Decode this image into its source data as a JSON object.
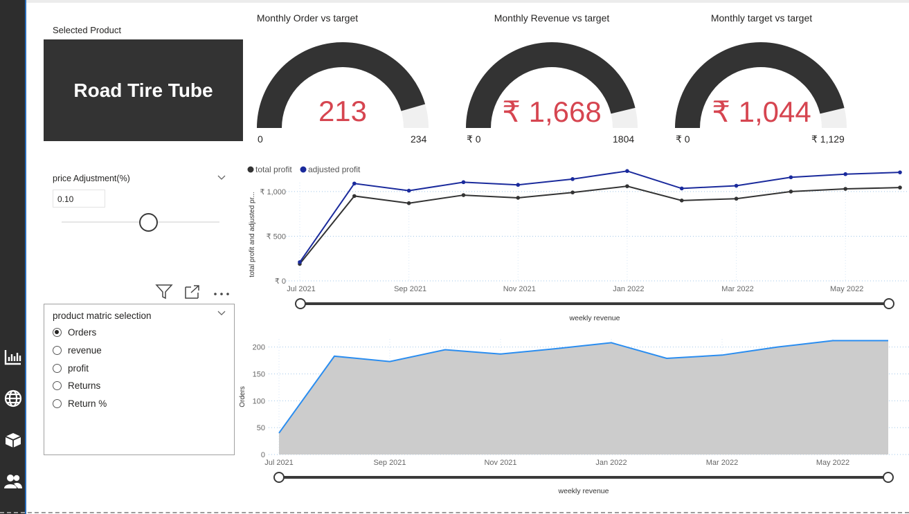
{
  "sidebar": {
    "icons": [
      "bar-chart-icon",
      "globe-icon",
      "box-icon",
      "users-icon"
    ]
  },
  "card": {
    "label": "Selected Product",
    "value": "Road Tire Tube"
  },
  "gauges": [
    {
      "title": "Monthly Order vs target",
      "value": "213",
      "min": "0",
      "max": "234",
      "value_num": 213,
      "max_num": 234
    },
    {
      "title": "Monthly Revenue vs target",
      "value": "₹ 1,668",
      "min": "₹ 0",
      "max": "1804",
      "value_num": 1668,
      "max_num": 1804
    },
    {
      "title": "Monthly target vs target",
      "value": "₹ 1,044",
      "min": "₹ 0",
      "max": "₹ 1,129",
      "value_num": 1044,
      "max_num": 1129
    }
  ],
  "price_slicer": {
    "title": "price Adjustment(%)",
    "value": "0.10",
    "level": 0.55
  },
  "radio": {
    "title": "product matric selection",
    "options": [
      "Orders",
      "revenue",
      "profit",
      "Returns",
      "Return %"
    ],
    "selected": 0
  },
  "colors": {
    "gauge_fill": "#333333",
    "gauge_bg": "#f0f0f0",
    "value_red": "#d64550",
    "adjusted": "#1a2a9c",
    "total": "#333333",
    "area_line": "#2a8df0",
    "area_fill": "#cccccc"
  },
  "chart_data": [
    {
      "type": "line",
      "legend": [
        "total profit",
        "adjusted profit"
      ],
      "legend_position": "top-left",
      "ylabel": "total profit and adjusted pr...",
      "xlabel": "weekly revenue",
      "x_ticks": [
        "Jul 2021",
        "Sep 2021",
        "Nov 2021",
        "Jan 2022",
        "Mar 2022",
        "May 2022"
      ],
      "y_ticks": [
        "₹ 0",
        "₹ 500",
        "₹ 1,000"
      ],
      "ylim": [
        0,
        1100
      ],
      "series": [
        {
          "name": "total profit",
          "values": [
            190,
            950,
            870,
            960,
            930,
            990,
            1060,
            900,
            920,
            1000,
            1030,
            1045
          ]
        },
        {
          "name": "adjusted profit",
          "values": [
            210,
            1090,
            1010,
            1105,
            1075,
            1140,
            1230,
            1035,
            1065,
            1160,
            1195,
            1215
          ]
        }
      ],
      "grid": true
    },
    {
      "type": "area",
      "ylabel": "Orders",
      "xlabel": "weekly revenue",
      "x_ticks": [
        "Jul 2021",
        "Sep 2021",
        "Nov 2021",
        "Jan 2022",
        "Mar 2022",
        "May 2022"
      ],
      "y_ticks": [
        "0",
        "50",
        "100",
        "150",
        "200"
      ],
      "ylim": [
        0,
        215
      ],
      "values": [
        40,
        183,
        173,
        195,
        187,
        197,
        208,
        179,
        185,
        200,
        212,
        212
      ],
      "grid": true
    }
  ]
}
